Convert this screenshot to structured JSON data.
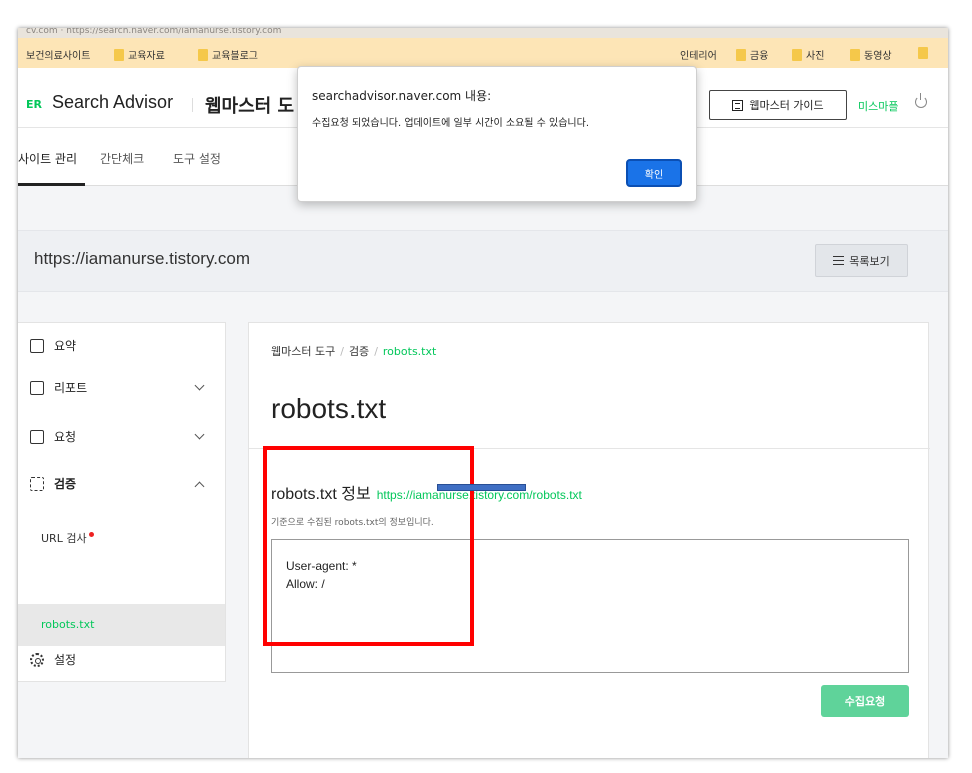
{
  "browser": {
    "address_text": "cv.com · https://search.naver.com/iamanurse.tistory.com",
    "bookmarks": [
      {
        "label": "보건의료사이트"
      },
      {
        "label": "교육자료"
      },
      {
        "label": "교육블로그"
      },
      {
        "label": "인테리어"
      },
      {
        "label": "금융"
      },
      {
        "label": "사진"
      },
      {
        "label": "동영상"
      }
    ]
  },
  "header": {
    "logo": "ER",
    "brand": "Search Advisor",
    "title": "웹마스터 도",
    "guide_label": "웹마스터 가이드",
    "user_label": "미스마플"
  },
  "tabs": [
    {
      "label": "사이트 관리"
    },
    {
      "label": "간단체크"
    },
    {
      "label": "도구 설정"
    }
  ],
  "site": {
    "url": "https://iamanurse.tistory.com",
    "list_button": "목록보기"
  },
  "sidebar": {
    "summary": "요약",
    "report": "리포트",
    "request": "요청",
    "verify": "검증",
    "url_check": "URL 검사",
    "robots": "robots.txt",
    "settings": "설정"
  },
  "content": {
    "breadcrumb": [
      "웹마스터 도구",
      "검증",
      "robots.txt"
    ],
    "title": "robots.txt",
    "info_title": "robots.txt 정보",
    "info_url": "https://iamanurse.tistory.com/robots.txt",
    "info_desc": "기준으로 수집된 robots.txt의 정보입니다.",
    "robots_lines": [
      "User-agent: *",
      "Allow: /"
    ],
    "submit_button": "수집요청"
  },
  "dialog": {
    "title": "searchadvisor.naver.com 내용:",
    "message": "수집요청 되었습니다. 업데이트에 일부 시간이 소요될 수 있습니다.",
    "ok_button": "확인"
  },
  "colors": {
    "accent_green": "#03c75a",
    "highlight_red": "#ff0000",
    "dialog_blue": "#1a73e8"
  }
}
